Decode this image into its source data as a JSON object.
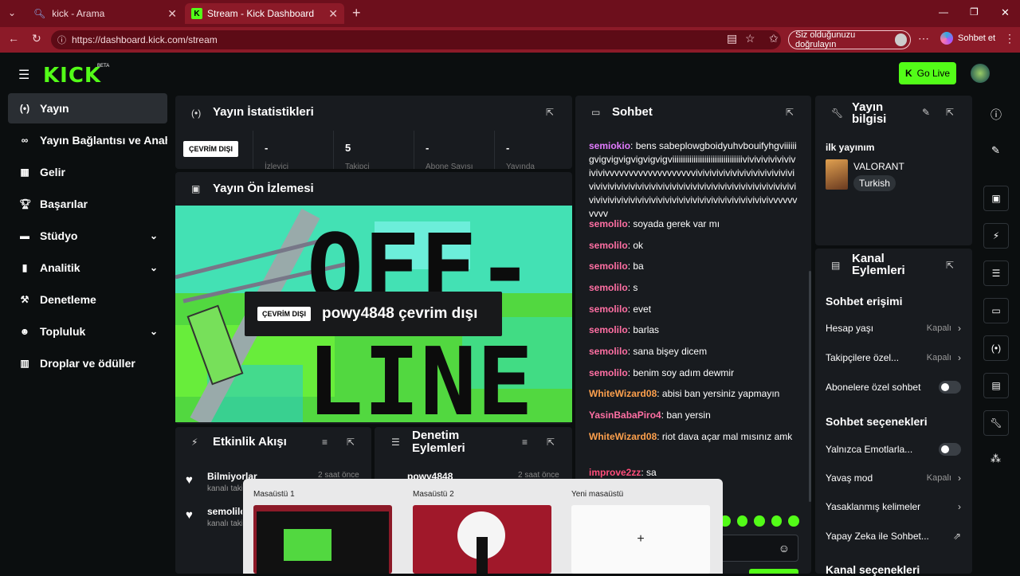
{
  "browser": {
    "tabs": [
      {
        "label": "kick - Arama"
      },
      {
        "label": "Stream - Kick Dashboard"
      }
    ],
    "url": "https://dashboard.kick.com/stream",
    "verify_label": "Siz olduğunuzu doğrulayın",
    "copilot_label": "Sohbet et"
  },
  "header": {
    "logo": "KICK",
    "beta": "BETA",
    "go_live": "Go Live"
  },
  "sidebar": {
    "items": [
      {
        "label": "Yayın"
      },
      {
        "label": "Yayın Bağlantısı ve Anahtarı"
      },
      {
        "label": "Gelir"
      },
      {
        "label": "Başarılar"
      },
      {
        "label": "Stüdyo"
      },
      {
        "label": "Analitik"
      },
      {
        "label": "Denetleme"
      },
      {
        "label": "Topluluk"
      },
      {
        "label": "Droplar ve ödüller"
      }
    ]
  },
  "stats": {
    "title": "Yayın İstatistikleri",
    "status_badge": "ÇEVRİM DIŞI",
    "items": [
      {
        "value": "-",
        "label": "İzleyici"
      },
      {
        "value": "5",
        "label": "Takipçi"
      },
      {
        "value": "-",
        "label": "Abone Sayısı"
      },
      {
        "value": "-",
        "label": "Yayında"
      }
    ]
  },
  "preview": {
    "title": "Yayın Ön İzlemesi",
    "badge": "ÇEVRİM DIŞI",
    "text": "powy4848 çevrim dışı",
    "art_line1": "OFF-",
    "art_line2": "LINE"
  },
  "activity": {
    "title": "Etkinlik Akışı",
    "items": [
      {
        "name": "Bilmiyorlar",
        "sub": "kanalı takip etti",
        "time": "2 saat önce"
      },
      {
        "name": "semolilo",
        "sub": "kanalı takip etti",
        "time": ""
      }
    ]
  },
  "moderation": {
    "title": "Denetim Eylemleri",
    "items": [
      {
        "name": "powy4848",
        "time": "2 saat önce"
      }
    ]
  },
  "chat": {
    "title": "Sohbet",
    "messages": [
      {
        "user": "semiokio",
        "text": "bens sabeplowgboidyuhvbouifyhgviiiiiigvigvigvigvigvigvigviiiiiiiiiiiiiiiiiiiiiiiiiiiiiiiiivivivivivivivivivivivvvvvvvvvvvvvvvvvvvivivivivivivivivivivivivivivivivivivivivivivivivivivivivivivivivivivivivivivivivivivivivivivivivivivivivivivivivivivivivivivivivivivivivivivivvvvvvvvvv"
      },
      {
        "user": "semolilo",
        "text": "soyada gerek var mı"
      },
      {
        "user": "semolilo",
        "text": "ok"
      },
      {
        "user": "semolilo",
        "text": "ba"
      },
      {
        "user": "semolilo",
        "text": "s"
      },
      {
        "user": "semolilo",
        "text": "evet"
      },
      {
        "user": "semolilo",
        "text": "barlas"
      },
      {
        "user": "semolilo",
        "text": "sana bişey dicem"
      },
      {
        "user": "semolilo",
        "text": "benim soy adım dewmir"
      },
      {
        "user": "WhiteWizard08",
        "text": "abisi ban yersiniz yapmayın"
      },
      {
        "user": "YasinBabaPiro4",
        "text": "ban yersin"
      },
      {
        "user": "WhiteWizard08",
        "text": "riot dava açar mal mısınız amk"
      },
      {
        "user": "improve2zz",
        "text": "sa"
      }
    ]
  },
  "stream_info": {
    "title": "Yayın bilgisi",
    "stream_title": "ilk yayınım",
    "game": "VALORANT",
    "language": "Turkish"
  },
  "channel_actions": {
    "title": "Kanal Eylemleri",
    "chat_access": "Sohbet erişimi",
    "account_age": {
      "label": "Hesap yaşı",
      "value": "Kapalı"
    },
    "followers_only": {
      "label": "Takipçilere özel...",
      "value": "Kapalı"
    },
    "subscribers_only": {
      "label": "Abonelere özel sohbet"
    },
    "chat_options": "Sohbet seçenekleri",
    "emote_only": {
      "label": "Yalnızca Emotlarla..."
    },
    "slow_mode": {
      "label": "Yavaş mod",
      "value": "Kapalı"
    },
    "banned_words": {
      "label": "Yasaklanmış kelimeler"
    },
    "ai_chat": {
      "label": "Yapay Zeka ile Sohbet..."
    },
    "channel_options": "Kanal seçenekleri"
  },
  "desktops": {
    "items": [
      {
        "label": "Masaüstü 1"
      },
      {
        "label": "Masaüstü 2"
      },
      {
        "label": "Yeni masaüstü"
      }
    ],
    "plus": "+"
  },
  "colors": {
    "brand": "#53fc18",
    "browser_bg": "#8c1a28",
    "panel": "#181b1f"
  }
}
